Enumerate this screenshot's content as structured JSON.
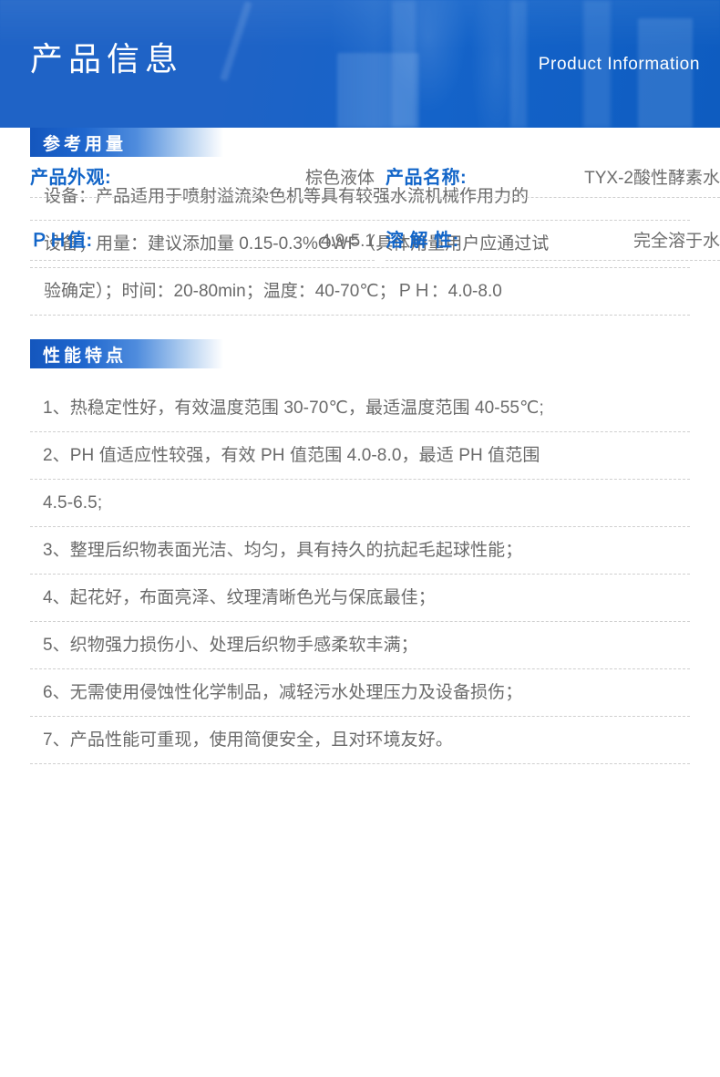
{
  "banner": {
    "title_cn": "产品信息",
    "title_en": "Product Information",
    "bg_color": "#1f63c6"
  },
  "specs": {
    "accent_color": "#1265c8",
    "value_color": "#6d6d6d",
    "rows": [
      {
        "label": "产品外观:",
        "value": "棕色液体"
      },
      {
        "label": "产品名称:",
        "value": "TYX-2酸性酵素水"
      },
      {
        "label": "ＰＨ值:",
        "value": "4.9-5.1"
      },
      {
        "label": "溶 解 性:",
        "value": "完全溶于水"
      }
    ]
  },
  "dosage": {
    "heading": "参考用量",
    "lines": [
      "设备：产品适用于喷射溢流染色机等具有较强水流机械作用力的",
      "设备；用量：建议添加量 0.15-0.3%OWF（具体用量用户应通过试",
      "验确定）；时间：20-80min；温度：40-70℃；ＰＨ：4.0-8.0"
    ]
  },
  "features": {
    "heading": "性能特点",
    "lines": [
      "1、热稳定性好，有效温度范围 30-70℃，最适温度范围 40-55℃;",
      "2、PH 值适应性较强，有效 PH 值范围 4.0-8.0，最适 PH 值范围",
      "4.5-6.5;",
      "3、整理后织物表面光洁、均匀，具有持久的抗起毛起球性能；",
      "4、起花好，布面亮泽、纹理清晰色光与保底最佳；",
      "5、织物强力损伤小、处理后织物手感柔软丰满；",
      "6、无需使用侵蚀性化学制品，减轻污水处理压力及设备损伤；",
      "7、产品性能可重现，使用简便安全，且对环境友好。"
    ]
  }
}
